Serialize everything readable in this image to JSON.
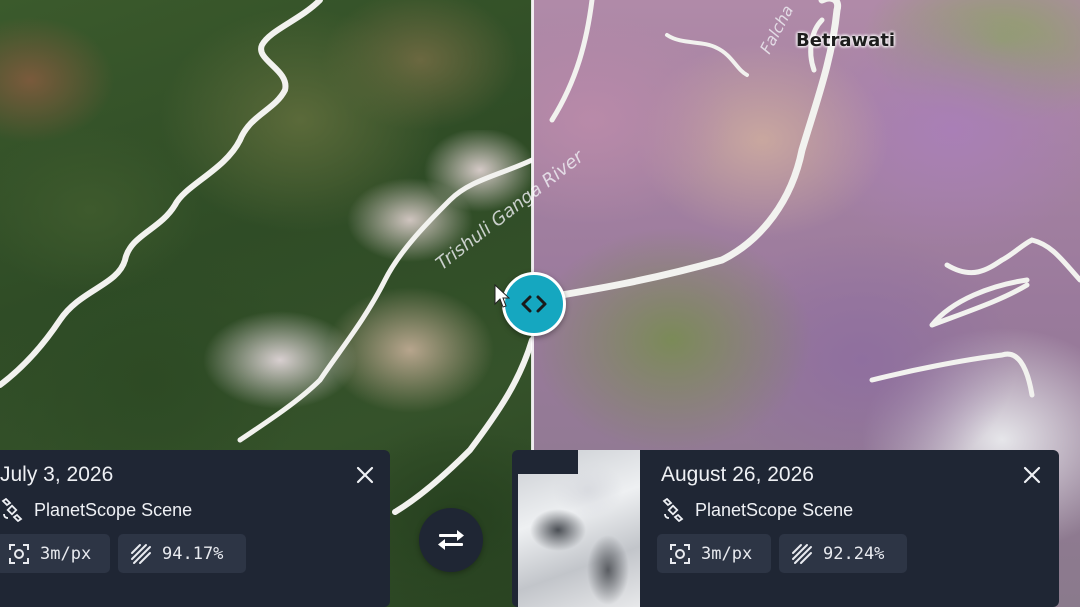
{
  "map": {
    "place_label": "Betrawati",
    "river_label": "Trishuli Ganga River",
    "road_label": "Falcha"
  },
  "compare": {
    "handle_icon": "code-brackets-icon",
    "swap_icon": "swap-arrows-icon"
  },
  "left_card": {
    "date": "July 3, 2026",
    "source": "PlanetScope Scene",
    "resolution": "3m/px",
    "coverage": "94.17%"
  },
  "right_card": {
    "date": "August 26, 2026",
    "source": "PlanetScope Scene",
    "resolution": "3m/px",
    "coverage": "92.24%"
  },
  "colors": {
    "accent": "#15a7c0",
    "card_bg": "#1f2634",
    "chip_bg": "#2d3545"
  }
}
